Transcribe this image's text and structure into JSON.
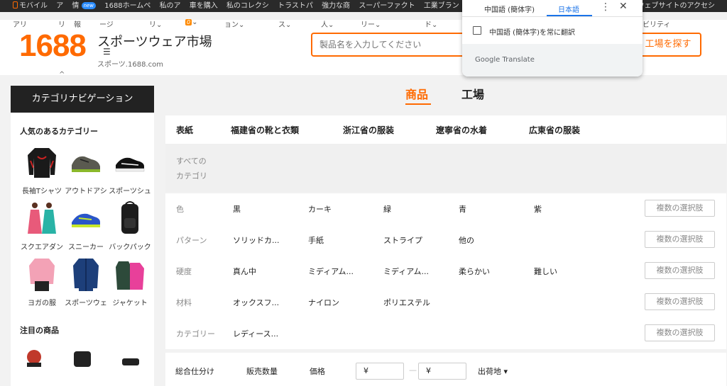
{
  "topbar": {
    "items": [
      "モバイル",
      "ア",
      "情",
      "1688ホームペ",
      "私のア",
      "車を購入",
      "私のコレクシ",
      "トラストパ",
      "強力な商",
      "スーパーファクト",
      "工業ブラン"
    ],
    "badge": "new",
    "right_text": "ウェブサイトのアクセシ"
  },
  "subnav": {
    "items": [
      "アリ",
      "リ",
      "報",
      "ージ",
      "リ",
      "0",
      "ョン",
      "ス",
      "人",
      "リー",
      "ド",
      "ビリティ"
    ]
  },
  "header": {
    "logo": "1688",
    "title": "スポーツウェア市場",
    "subtitle": "スポーツ.1688.com",
    "menu_glyph": "☰",
    "search_placeholder": "製品名を入力してください",
    "search_button": "工場を探す",
    "caret_glyph": "^"
  },
  "sidebar": {
    "title": "カテゴリナビゲーション",
    "popular_title": "人気のあるカテゴリー",
    "products": [
      {
        "name": "長袖Tシャツ"
      },
      {
        "name": "アウトドアシ"
      },
      {
        "name": "スポーツシュ"
      },
      {
        "name": "スクエアダン"
      },
      {
        "name": "スニーカー"
      },
      {
        "name": "バックパック"
      },
      {
        "name": "ヨガの服"
      },
      {
        "name": "スポーツウェ"
      },
      {
        "name": "ジャケット"
      }
    ],
    "featured_title": "注目の商品"
  },
  "main": {
    "tabs": [
      {
        "label": "商品"
      },
      {
        "label": "工場"
      }
    ],
    "categories": [
      "表紙",
      "福建省の靴と衣類",
      "浙江省の服装",
      "遼寧省の水着",
      "広東省の服装"
    ],
    "all_categories": "すべての\nカテゴリ",
    "filters": [
      {
        "label": "色",
        "options": [
          "黒",
          "カーキ",
          "緑",
          "青",
          "紫"
        ]
      },
      {
        "label": "パターン",
        "options": [
          "ソリッドカ...",
          "手紙",
          "ストライプ",
          "他の"
        ]
      },
      {
        "label": "硬度",
        "options": [
          "真ん中",
          "ミディアム...",
          "ミディアム...",
          "柔らかい",
          "難しい"
        ]
      },
      {
        "label": "材料",
        "options": [
          "オックスフ...",
          "ナイロン",
          "ポリエステル"
        ]
      },
      {
        "label": "カテゴリー",
        "options": [
          "レディース..."
        ]
      }
    ],
    "multi_select_label": "複数の選択肢",
    "sort": {
      "overall": "総合仕分け",
      "sales": "販売数量",
      "price": "価格",
      "price_min": "¥",
      "price_max": "¥",
      "dash": "—",
      "origin": "出荷地 ▾"
    }
  },
  "translate_popup": {
    "lang_source": "中国語 (簡体字)",
    "lang_target": "日本語",
    "always_translate": "中国語 (簡体字)を常に翻訳",
    "footer": "Google Translate"
  },
  "colors": {
    "accent": "#ff6a00",
    "dark": "#222222",
    "google_blue": "#1a73e8"
  }
}
